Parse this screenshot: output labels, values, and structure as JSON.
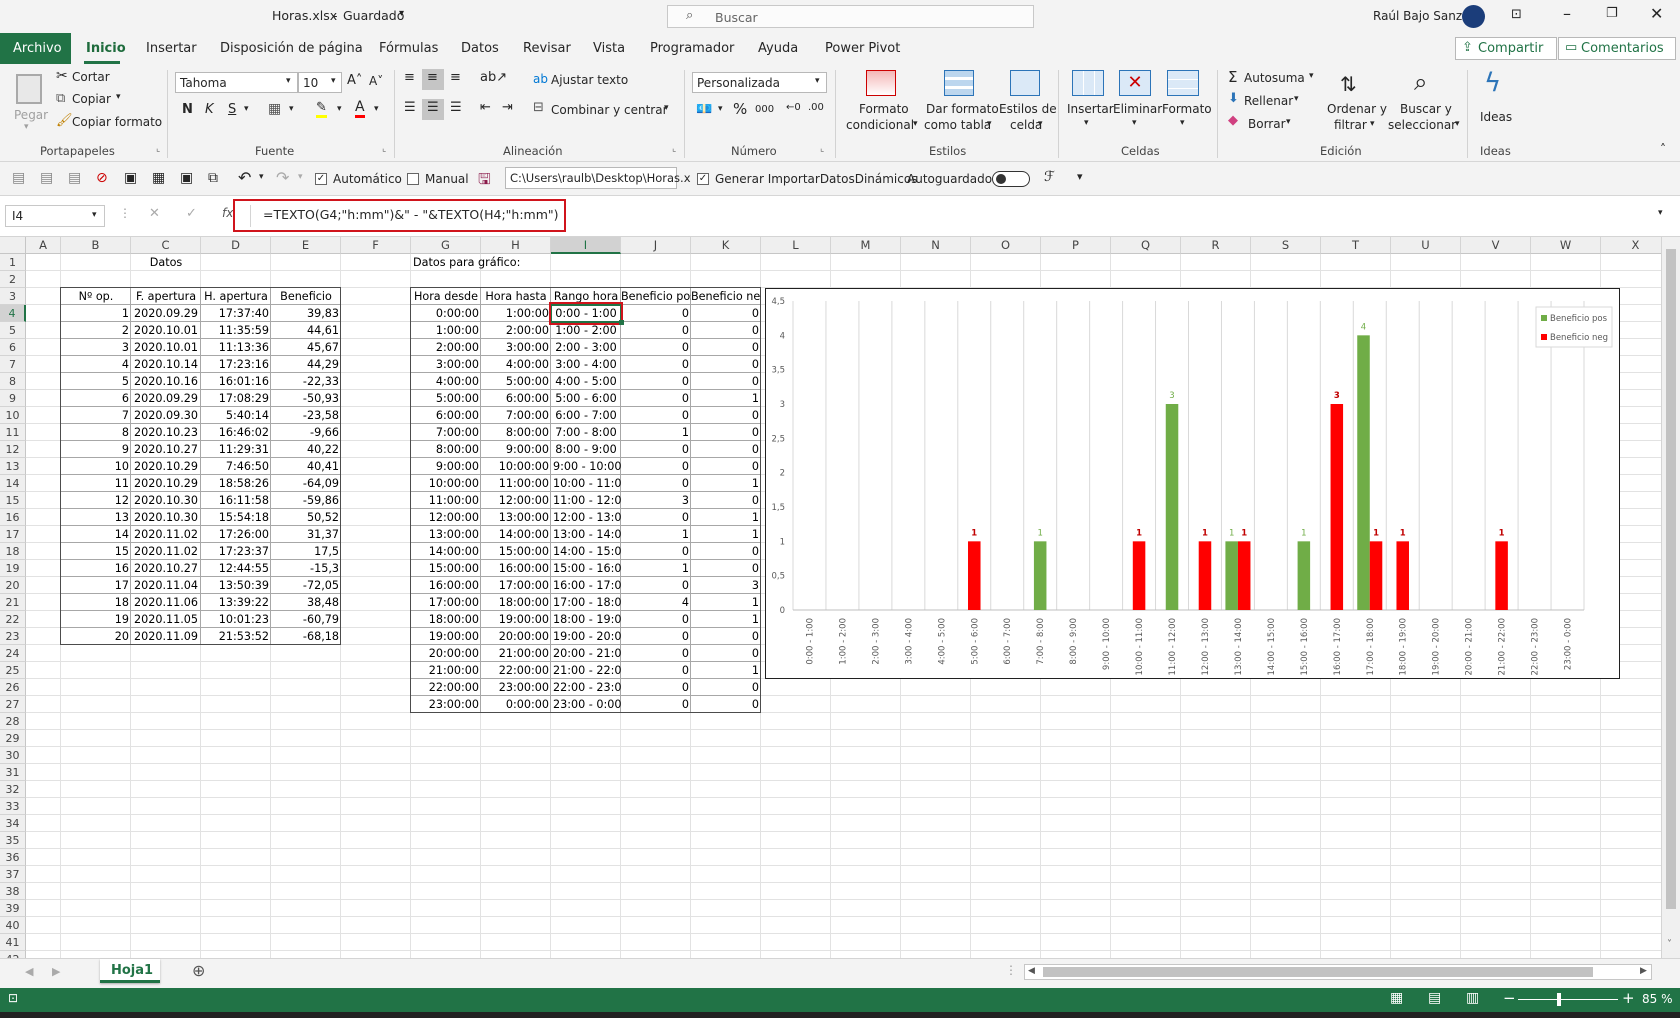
{
  "title": {
    "file": "Horas.xlsx",
    "sep": "-",
    "status": "Guardado",
    "search": "Buscar",
    "user": "Raúl Bajo Sanz"
  },
  "tabs": [
    "Archivo",
    "Inicio",
    "Insertar",
    "Disposición de página",
    "Fórmulas",
    "Datos",
    "Revisar",
    "Vista",
    "Programador",
    "Ayuda",
    "Power Pivot"
  ],
  "share": "Compartir",
  "comments": "Comentarios",
  "ribbon": {
    "clipboard": {
      "paste": "Pegar",
      "cut": "Cortar",
      "copy": "Copiar",
      "format": "Copiar formato",
      "group": "Portapapeles"
    },
    "font": {
      "name": "Tahoma",
      "size": "10",
      "bold": "N",
      "italic": "K",
      "underline": "S",
      "group": "Fuente"
    },
    "align": {
      "wrap": "Ajustar texto",
      "merge": "Combinar y centrar",
      "group": "Alineación"
    },
    "number": {
      "format": "Personalizada",
      "group": "Número"
    },
    "styles": {
      "cond": [
        "Formato",
        "condicional"
      ],
      "table": [
        "Dar formato",
        "como tabla"
      ],
      "cell": [
        "Estilos de",
        "celda"
      ],
      "group": "Estilos"
    },
    "cells": {
      "insert": "Insertar",
      "delete": "Eliminar",
      "format": "Formato",
      "group": "Celdas"
    },
    "edit": {
      "autosum": "Autosuma",
      "fill": "Rellenar",
      "clear": "Borrar",
      "sort": [
        "Ordenar y",
        "filtrar"
      ],
      "find": [
        "Buscar y",
        "seleccionar"
      ],
      "group": "Edición"
    },
    "ideas": {
      "label": "Ideas",
      "group": "Ideas"
    }
  },
  "qat": {
    "auto": "Automático",
    "manual": "Manual",
    "path": "C:\\Users\\raulb\\Desktop\\Horas.x",
    "gen": "Generar ImportarDatosDinámicos",
    "autosave": "Autoguardado"
  },
  "namebox": "I4",
  "formula": "=TEXTO(G4;\"h:mm\")&\" - \"&TEXTO(H4;\"h:mm\")",
  "columns": [
    "A",
    "B",
    "C",
    "D",
    "E",
    "F",
    "G",
    "H",
    "I",
    "J",
    "K",
    "L",
    "M",
    "N",
    "O",
    "P",
    "Q",
    "R",
    "S",
    "T",
    "U",
    "V",
    "W",
    "X"
  ],
  "rows_count": 42,
  "headers": {
    "datos": "Datos",
    "grafico": "Datos para gráfico:",
    "op": "Nº op.",
    "fap": "F. apertura",
    "hap": "H. apertura",
    "ben": "Beneficio",
    "desde": "Hora desde",
    "hasta": "Hora hasta",
    "rango": "Rango hora",
    "pos": "Beneficio pos",
    "neg": "Beneficio neg"
  },
  "ops": [
    [
      "1",
      "2020.09.29",
      "17:37:40",
      "39,83"
    ],
    [
      "2",
      "2020.10.01",
      "11:35:59",
      "44,61"
    ],
    [
      "3",
      "2020.10.01",
      "11:13:36",
      "45,67"
    ],
    [
      "4",
      "2020.10.14",
      "17:23:16",
      "44,29"
    ],
    [
      "5",
      "2020.10.16",
      "16:01:16",
      "-22,33"
    ],
    [
      "6",
      "2020.09.29",
      "17:08:29",
      "-50,93"
    ],
    [
      "7",
      "2020.09.30",
      "5:40:14",
      "-23,58"
    ],
    [
      "8",
      "2020.10.23",
      "16:46:02",
      "-9,66"
    ],
    [
      "9",
      "2020.10.27",
      "11:29:31",
      "40,22"
    ],
    [
      "10",
      "2020.10.29",
      "7:46:50",
      "40,41"
    ],
    [
      "11",
      "2020.10.29",
      "18:58:26",
      "-64,09"
    ],
    [
      "12",
      "2020.10.30",
      "16:11:58",
      "-59,86"
    ],
    [
      "13",
      "2020.10.30",
      "15:54:18",
      "50,52"
    ],
    [
      "14",
      "2020.11.02",
      "17:26:00",
      "31,37"
    ],
    [
      "15",
      "2020.11.02",
      "17:23:37",
      "17,5"
    ],
    [
      "16",
      "2020.10.27",
      "12:44:55",
      "-15,3"
    ],
    [
      "17",
      "2020.11.04",
      "13:50:39",
      "-72,05"
    ],
    [
      "18",
      "2020.11.06",
      "13:39:22",
      "38,48"
    ],
    [
      "19",
      "2020.11.05",
      "10:01:23",
      "-60,79"
    ],
    [
      "20",
      "2020.11.09",
      "21:53:52",
      "-68,18"
    ]
  ],
  "hours": [
    [
      "0:00:00",
      "1:00:00",
      "0:00 - 1:00",
      "0",
      "0"
    ],
    [
      "1:00:00",
      "2:00:00",
      "1:00 - 2:00",
      "0",
      "0"
    ],
    [
      "2:00:00",
      "3:00:00",
      "2:00 - 3:00",
      "0",
      "0"
    ],
    [
      "3:00:00",
      "4:00:00",
      "3:00 - 4:00",
      "0",
      "0"
    ],
    [
      "4:00:00",
      "5:00:00",
      "4:00 - 5:00",
      "0",
      "0"
    ],
    [
      "5:00:00",
      "6:00:00",
      "5:00 - 6:00",
      "0",
      "1"
    ],
    [
      "6:00:00",
      "7:00:00",
      "6:00 - 7:00",
      "0",
      "0"
    ],
    [
      "7:00:00",
      "8:00:00",
      "7:00 - 8:00",
      "1",
      "0"
    ],
    [
      "8:00:00",
      "9:00:00",
      "8:00 - 9:00",
      "0",
      "0"
    ],
    [
      "9:00:00",
      "10:00:00",
      "9:00 - 10:00",
      "0",
      "0"
    ],
    [
      "10:00:00",
      "11:00:00",
      "10:00 - 11:00",
      "0",
      "1"
    ],
    [
      "11:00:00",
      "12:00:00",
      "11:00 - 12:00",
      "3",
      "0"
    ],
    [
      "12:00:00",
      "13:00:00",
      "12:00 - 13:00",
      "0",
      "1"
    ],
    [
      "13:00:00",
      "14:00:00",
      "13:00 - 14:00",
      "1",
      "1"
    ],
    [
      "14:00:00",
      "15:00:00",
      "14:00 - 15:00",
      "0",
      "0"
    ],
    [
      "15:00:00",
      "16:00:00",
      "15:00 - 16:00",
      "1",
      "0"
    ],
    [
      "16:00:00",
      "17:00:00",
      "16:00 - 17:00",
      "0",
      "3"
    ],
    [
      "17:00:00",
      "18:00:00",
      "17:00 - 18:00",
      "4",
      "1"
    ],
    [
      "18:00:00",
      "19:00:00",
      "18:00 - 19:00",
      "0",
      "1"
    ],
    [
      "19:00:00",
      "20:00:00",
      "19:00 - 20:00",
      "0",
      "0"
    ],
    [
      "20:00:00",
      "21:00:00",
      "20:00 - 21:00",
      "0",
      "0"
    ],
    [
      "21:00:00",
      "22:00:00",
      "21:00 - 22:00",
      "0",
      "1"
    ],
    [
      "22:00:00",
      "23:00:00",
      "22:00 - 23:00",
      "0",
      "0"
    ],
    [
      "23:00:00",
      "0:00:00",
      "23:00 - 0:00",
      "0",
      "0"
    ]
  ],
  "chart_data": {
    "type": "bar",
    "categories": [
      "0:00 - 1:00",
      "1:00 - 2:00",
      "2:00 - 3:00",
      "3:00 - 4:00",
      "4:00 - 5:00",
      "5:00 - 6:00",
      "6:00 - 7:00",
      "7:00 - 8:00",
      "8:00 - 9:00",
      "9:00 - 10:00",
      "10:00 - 11:00",
      "11:00 - 12:00",
      "12:00 - 13:00",
      "13:00 - 14:00",
      "14:00 - 15:00",
      "15:00 - 16:00",
      "16:00 - 17:00",
      "17:00 - 18:00",
      "18:00 - 19:00",
      "19:00 - 20:00",
      "20:00 - 21:00",
      "21:00 - 22:00",
      "22:00 - 23:00",
      "23:00 - 0:00"
    ],
    "series": [
      {
        "name": "Beneficio pos",
        "color": "#70ad47",
        "values": [
          0,
          0,
          0,
          0,
          0,
          0,
          0,
          1,
          0,
          0,
          0,
          3,
          0,
          1,
          0,
          1,
          0,
          4,
          0,
          0,
          0,
          0,
          0,
          0
        ]
      },
      {
        "name": "Beneficio neg",
        "color": "#ff0000",
        "values": [
          0,
          0,
          0,
          0,
          0,
          1,
          0,
          0,
          0,
          0,
          1,
          0,
          1,
          1,
          0,
          0,
          3,
          1,
          1,
          0,
          0,
          1,
          0,
          0
        ]
      }
    ],
    "yticks": [
      "0",
      "0,5",
      "1",
      "1,5",
      "2",
      "2,5",
      "3",
      "3,5",
      "4",
      "4,5"
    ],
    "ylim": [
      0,
      4.5
    ],
    "legend": "top-right",
    "grid": "vertical"
  },
  "sheet_tab": "Hoja1",
  "zoom": "85 %"
}
